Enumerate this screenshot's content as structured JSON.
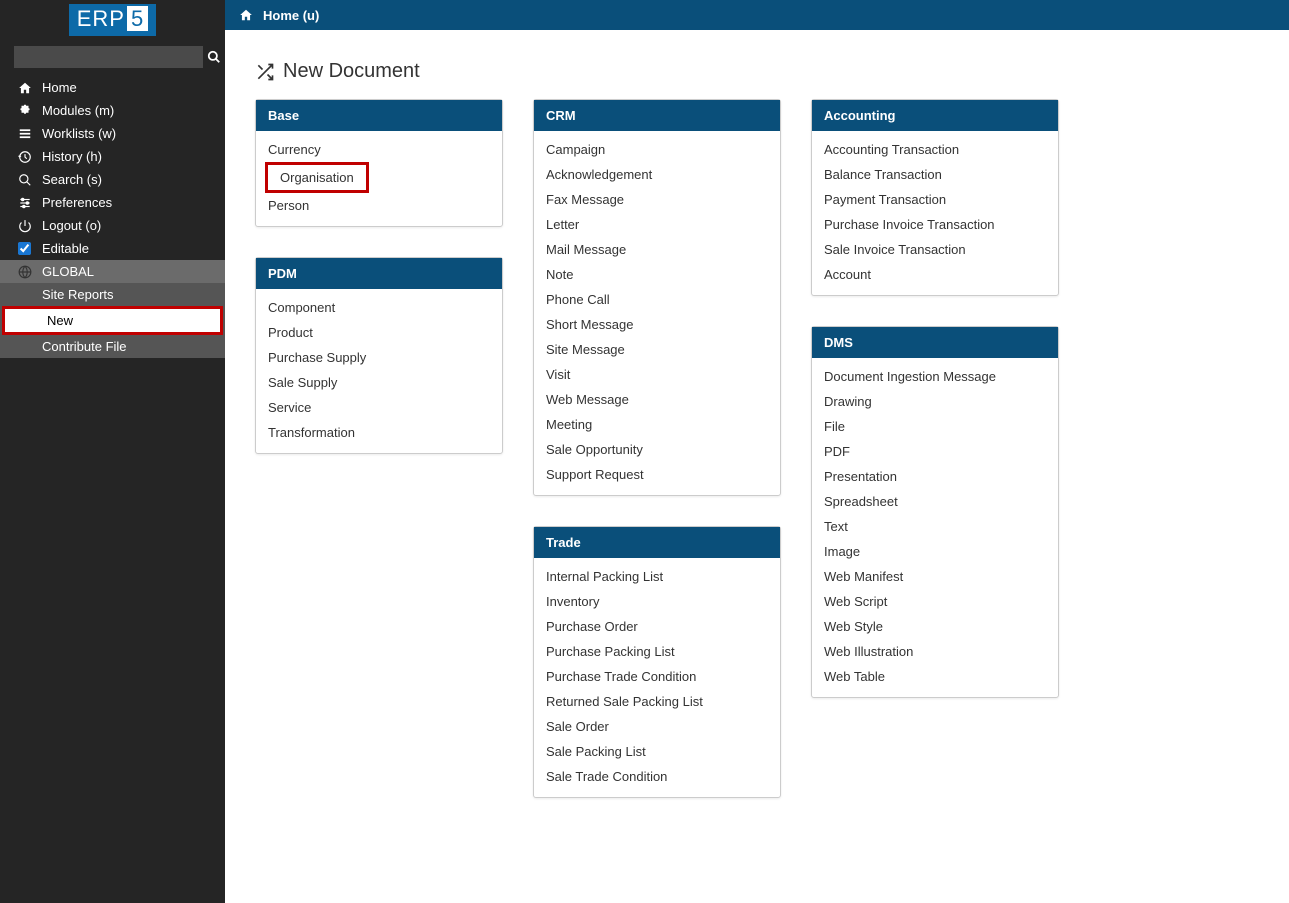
{
  "logo_text": "ERP",
  "logo_suffix": "5",
  "search_placeholder": "",
  "nav": [
    {
      "icon": "home",
      "label": "Home"
    },
    {
      "icon": "puzzle",
      "label": "Modules (m)"
    },
    {
      "icon": "list",
      "label": "Worklists (w)"
    },
    {
      "icon": "history",
      "label": "History (h)"
    },
    {
      "icon": "search",
      "label": "Search (s)"
    },
    {
      "icon": "sliders",
      "label": "Preferences"
    },
    {
      "icon": "power",
      "label": "Logout (o)"
    },
    {
      "icon": "check",
      "label": "Editable"
    }
  ],
  "global_header": "GLOBAL",
  "global_items": [
    {
      "label": "Site Reports",
      "active": false
    },
    {
      "label": "New",
      "active": true
    },
    {
      "label": "Contribute File",
      "active": false
    }
  ],
  "breadcrumb": "Home (u)",
  "page_title": "New Document",
  "highlighted_item": "Organisation",
  "panels": [
    {
      "title": "Base",
      "items": [
        "Currency",
        "Organisation",
        "Person"
      ]
    },
    {
      "title": "CRM",
      "items": [
        "Campaign",
        "Acknowledgement",
        "Fax Message",
        "Letter",
        "Mail Message",
        "Note",
        "Phone Call",
        "Short Message",
        "Site Message",
        "Visit",
        "Web Message",
        "Meeting",
        "Sale Opportunity",
        "Support Request"
      ]
    },
    {
      "title": "Accounting",
      "items": [
        "Accounting Transaction",
        "Balance Transaction",
        "Payment Transaction",
        "Purchase Invoice Transaction",
        "Sale Invoice Transaction",
        "Account"
      ]
    },
    {
      "title": "PDM",
      "items": [
        "Component",
        "Product",
        "Purchase Supply",
        "Sale Supply",
        "Service",
        "Transformation"
      ]
    },
    {
      "title": "Trade",
      "items": [
        "Internal Packing List",
        "Inventory",
        "Purchase Order",
        "Purchase Packing List",
        "Purchase Trade Condition",
        "Returned Sale Packing List",
        "Sale Order",
        "Sale Packing List",
        "Sale Trade Condition"
      ]
    },
    {
      "title": "DMS",
      "items": [
        "Document Ingestion Message",
        "Drawing",
        "File",
        "PDF",
        "Presentation",
        "Spreadsheet",
        "Text",
        "Image",
        "Web Manifest",
        "Web Script",
        "Web Style",
        "Web Illustration",
        "Web Table"
      ]
    }
  ]
}
